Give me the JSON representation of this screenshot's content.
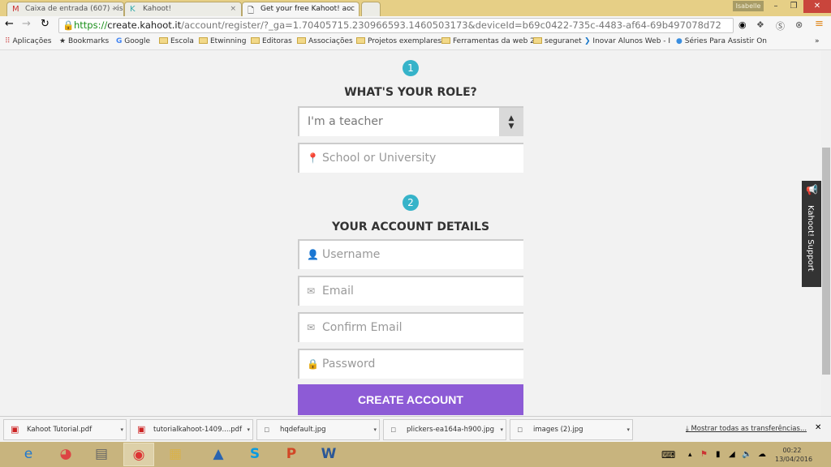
{
  "browser": {
    "tabs": [
      {
        "label": "Caixa de entrada (607) - is",
        "icon": "gmail-icon"
      },
      {
        "label": "Kahoot!",
        "icon": "kahoot-icon"
      },
      {
        "label": "Get your free Kahoot! acc",
        "icon": "page-icon",
        "active": true
      }
    ],
    "user": "Isabelle",
    "url": {
      "scheme": "https://",
      "domain": "create.kahoot.it",
      "path": "/account/register/?_ga=1.70405715.230966593.1460503173&deviceId=b69c0422-735c-4483-af64-69b497078d72"
    },
    "bookmarks": [
      "Aplicações",
      "Bookmarks",
      "Google",
      "Escola",
      "Etwinning",
      "Editoras",
      "Associações",
      "Projetos exemplares",
      "Ferramentas da web 2",
      "seguranet",
      "Inovar Alunos Web - I",
      "Séries Para Assistir On"
    ]
  },
  "form": {
    "step1": "1",
    "role_heading": "WHAT'S YOUR ROLE?",
    "role_value": "I'm a teacher",
    "school_placeholder": "School or University",
    "step2": "2",
    "account_heading": "YOUR ACCOUNT DETAILS",
    "username_placeholder": "Username",
    "email_placeholder": "Email",
    "confirm_placeholder": "Confirm Email",
    "password_placeholder": "Password",
    "create_label": "CREATE ACCOUNT",
    "accent": "#8d5bd6",
    "step_color": "#36b3c9"
  },
  "support": "Kahoot! Support",
  "downloads": {
    "items": [
      "Kahoot Tutorial.pdf",
      "tutorialkahoot-1409....pdf",
      "hqdefault.jpg",
      "plickers-ea164a-h900.jpg",
      "images (2).jpg"
    ],
    "show_all": "Mostrar todas as  transferências..."
  },
  "taskbar": {
    "time": "00:22",
    "date": "13/04/2016"
  }
}
